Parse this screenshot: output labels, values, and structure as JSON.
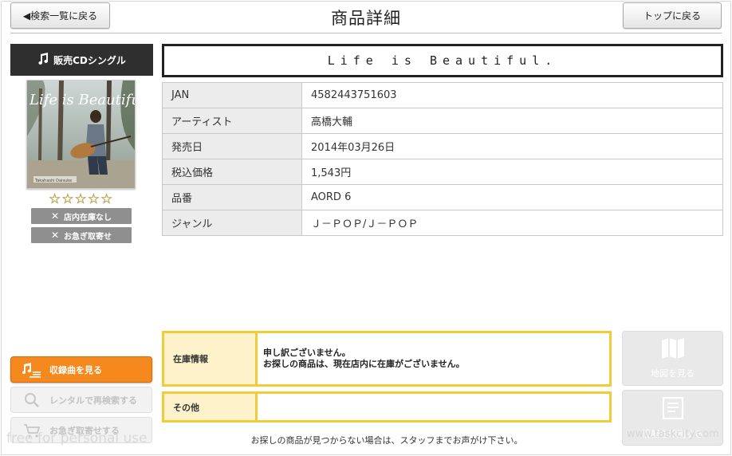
{
  "header": {
    "back_label": "◀検索一覧に戻る",
    "title": "商品詳細",
    "top_label": "トップに戻る"
  },
  "sidebar": {
    "category_label": "販売CDシングル",
    "cover_title_text": "Life is Beautiful",
    "cover_artist_text": "Takahashi Daisuke",
    "rating": 0,
    "rating_max": 5,
    "stock_status_label": "店内在庫なし",
    "order_status_label": "お急ぎ取寄せ"
  },
  "product": {
    "title": "Life is Beautiful.",
    "fields": [
      {
        "key": "JAN",
        "value": "4582443751603"
      },
      {
        "key": "アーティスト",
        "value": "高橋大輔"
      },
      {
        "key": "発売日",
        "value": "2014年03月26日"
      },
      {
        "key": "税込価格",
        "value": "1,543円"
      },
      {
        "key": "品番",
        "value": "AORD 6"
      },
      {
        "key": "ジャンル",
        "value": "Ｊ－ＰＯＰ/Ｊ－ＰＯＰ"
      }
    ]
  },
  "actions": {
    "tracks_label": "収録曲を見る",
    "rental_search_label": "レンタルで再検索する",
    "rush_order_label": "お急ぎ取寄せする"
  },
  "stock": {
    "stock_key": "在庫情報",
    "stock_line1": "申し訳ございません。",
    "stock_line2": "お探しの商品は、現在店内に在庫がございません。",
    "other_key": "その他",
    "other_value": ""
  },
  "footer_note": "お探しの商品が見つからない場合は、スタッフまでお声がけ下さい。",
  "right_tiles": {
    "map_label": "地図を見る",
    "print_label": "情報を印刷する"
  },
  "watermarks": {
    "left": "free for personal use",
    "right": "www.taskcity.com"
  },
  "colors": {
    "accent_orange": "#f5891e",
    "stock_border": "#f2cc38",
    "stock_key_bg": "#fdf2c9",
    "category_bg": "#2f2f2f"
  },
  "icons": {
    "category": "music-note-icon",
    "tracks": "music-list-icon",
    "rental_search": "search-icon",
    "rush_order": "cart-icon",
    "map": "map-icon",
    "print": "document-icon"
  }
}
